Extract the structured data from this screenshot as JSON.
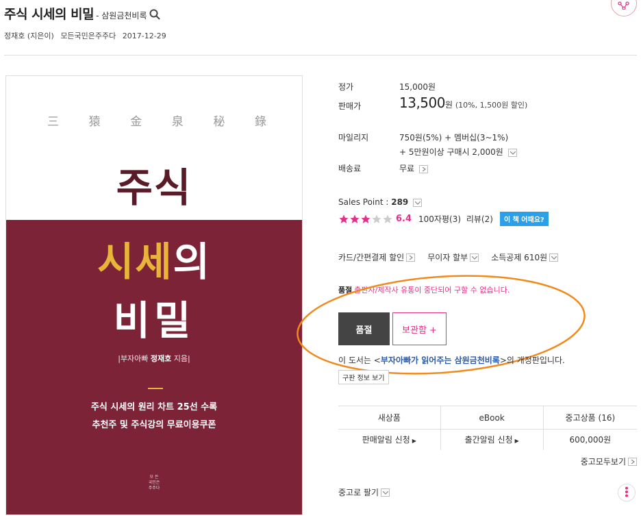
{
  "header": {
    "title": "주식 시세의 비밀",
    "subtitle": "- 삼원금천비록",
    "author": "정재호 (지은이)",
    "publisher": "모든국민은주주다",
    "date": "2017-12-29"
  },
  "cover": {
    "hanja": [
      "三",
      "猿",
      "金",
      "泉",
      "秘",
      "錄"
    ],
    "title_line1": "주식",
    "title_line2_a": "시세",
    "title_line2_b": "의",
    "title_line3": "비밀",
    "author_prefix": "|부자아빠 ",
    "author_name": "정재호",
    "author_suffix": " 지음|",
    "desc1": "주식 시세의 원리 차트 25선 수록",
    "desc2": "추천주 및 주식강의 무료이용쿠폰",
    "pub_line1": "모 든",
    "pub_line2": "국민은",
    "pub_line3": "주주다"
  },
  "price": {
    "list_label": "정가",
    "list_value": "15,000원",
    "sale_label": "판매가",
    "sale_value": "13,500",
    "sale_unit": "원",
    "sale_discount": "(10%, 1,500원 할인)"
  },
  "mileage": {
    "label": "마일리지",
    "line1": "750원(5%) + 멤버십(3~1%)",
    "line2": "+ 5만원이상 구매시 2,000원"
  },
  "shipping": {
    "label": "배송료",
    "value": "무료"
  },
  "sales_point": {
    "label": "Sales Point : ",
    "value": "289"
  },
  "rating": {
    "stars_filled": 3,
    "stars_total": 5,
    "score": "6.4",
    "review100": "100자평(3)",
    "review": "리뷰(2)",
    "howabout": "이 책 어때요?"
  },
  "options": {
    "card": "카드/간편결제 할인",
    "installment": "무이자 할부",
    "tax": "소득공제 610원"
  },
  "soldout": {
    "label": "품절",
    "message": "출판사/제작사 유통이 중단되어 구할 수 없습니다."
  },
  "buttons": {
    "soldout": "품절",
    "keep": "보관함 +"
  },
  "edition": {
    "prefix": "이 도서는 <",
    "link": "부자아빠가 읽어주는 삼원금천비록",
    "suffix": ">의 개정판입니다.",
    "old_button": "구판 정보 보기"
  },
  "buy_table": {
    "headers": [
      "새상품",
      "eBook",
      "중고상품 (16)"
    ],
    "cells": [
      "판매알림 신청",
      "출간알림 신청",
      "600,000원"
    ]
  },
  "used": {
    "view_all": "중고모두보기",
    "sell": "중고로 팔기"
  },
  "colors": {
    "accent": "#e62e8b",
    "cover_bg": "#7c2338",
    "gold": "#e8b43a",
    "highlight": "#f08a1c"
  }
}
